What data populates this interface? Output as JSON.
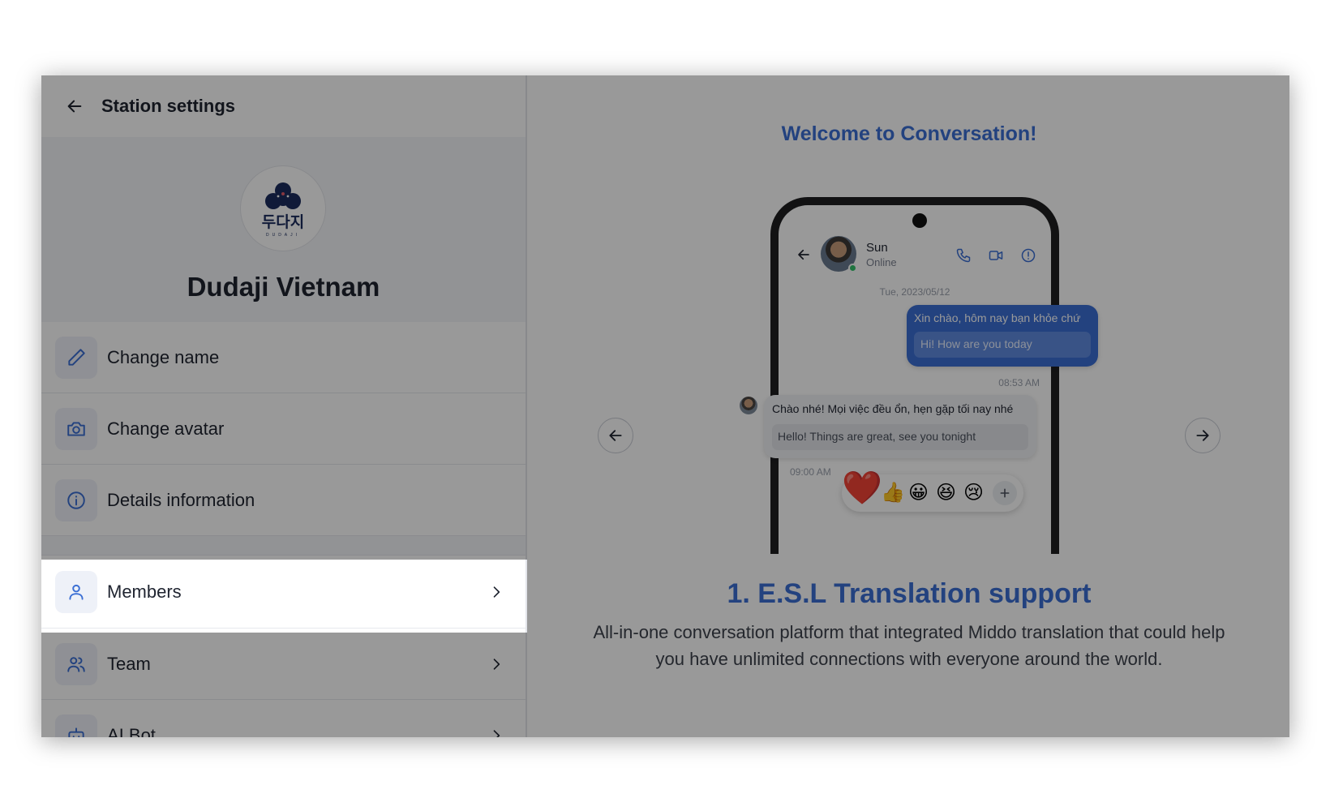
{
  "header": {
    "title": "Station settings"
  },
  "station": {
    "name": "Dudaji Vietnam",
    "logo_text": "두다지",
    "logo_subtext": "DUDAJI"
  },
  "menu": {
    "change_name": "Change name",
    "change_avatar": "Change avatar",
    "details": "Details information",
    "members": "Members",
    "team": "Team",
    "ai_bot": "AI Bot"
  },
  "welcome": {
    "title": "Welcome to Conversation!"
  },
  "chat": {
    "contact_name": "Sun",
    "contact_status": "Online",
    "date": "Tue, 2023/05/12",
    "outgoing": {
      "original": "Xin chào, hôm nay bạn khỏe chứ",
      "translation": "Hi! How are you today",
      "time": "08:53 AM"
    },
    "incoming": {
      "original": "Chào nhé! Mọi việc đều ổn, hẹn gặp tối nay nhé",
      "translation": "Hello! Things are great, see you tonight",
      "time": "09:00 AM"
    },
    "reactions": [
      "❤️",
      "👍",
      "😀",
      "😆",
      "😢"
    ]
  },
  "slide": {
    "title": "1. E.S.L Translation support",
    "description": "All-in-one conversation platform that integrated Middo translation that could help you have unlimited connections with everyone around the world."
  },
  "colors": {
    "accent": "#3b6fd4",
    "text": "#1f2430",
    "icon_bg": "#eef1f8"
  }
}
